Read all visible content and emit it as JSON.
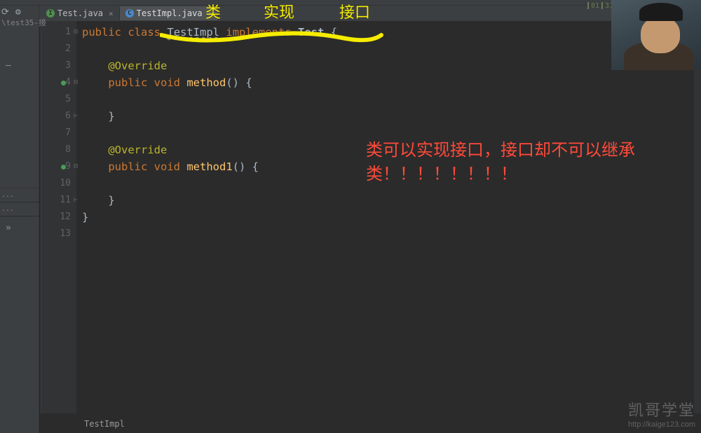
{
  "breadcrumb": "\\test35-接",
  "tabs": [
    {
      "name": "Test.java",
      "kind": "I"
    },
    {
      "name": "TestImpl.java",
      "kind": "C"
    }
  ],
  "activeTabIndex": 1,
  "status": {
    "line": "01",
    "col": "31"
  },
  "gutter": [
    "1",
    "2",
    "3",
    "4",
    "5",
    "6",
    "7",
    "8",
    "9",
    "10",
    "11",
    "12",
    "13"
  ],
  "code": {
    "l1": {
      "kw1": "public",
      "kw2": "class",
      "name": "TestImpl",
      "kw3": "implements",
      "iface": "Test",
      "brace": "{"
    },
    "l3": {
      "ann": "@Override"
    },
    "l4": {
      "kw1": "public",
      "kw2": "void",
      "mth": "method",
      "rest": "() {"
    },
    "l6": {
      "brace": "}"
    },
    "l8": {
      "ann": "@Override"
    },
    "l9": {
      "kw1": "public",
      "kw2": "void",
      "mth": "method1",
      "rest": "() {"
    },
    "l11": {
      "brace": "}"
    },
    "l12": {
      "brace": "}"
    }
  },
  "annotations": {
    "top1": "类",
    "top2": "实现",
    "top3": "接口",
    "red_line1": "类可以实现接口，接口却不可以继承",
    "red_line2": "类！！！！！！！！"
  },
  "breadcrumb_bottom": "TestImpl",
  "watermark": {
    "title": "凯哥学堂",
    "url": "http://kaige123.com"
  }
}
